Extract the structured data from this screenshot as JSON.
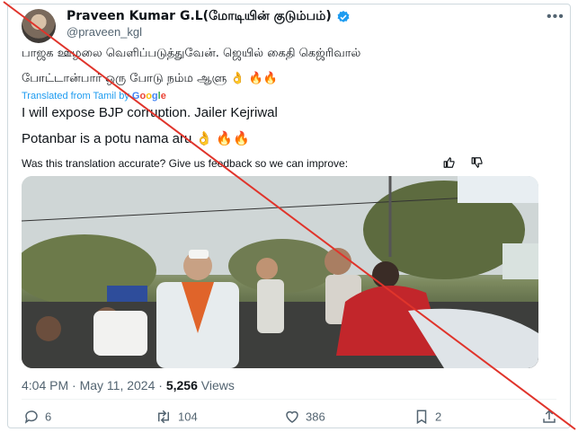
{
  "author": {
    "name": "Praveen Kumar G.L(மோடியின் குடும்பம்)",
    "handle": "@praveen_kgl"
  },
  "tweet": {
    "tamil_line1": "பாஜக ஊழலை வெளிப்படுத்துவேன். ஜெயில் கைதி கெஜ்ரிவால்",
    "tamil_line2": "போட்டான்பார் ஒரு போடு நம்ம ஆளு 👌 🔥🔥",
    "translated_label": "Translated from Tamil by",
    "translated_provider": [
      "G",
      "o",
      "o",
      "g",
      "l",
      "e"
    ],
    "english_line1": "I will expose BJP corruption. Jailer Kejriwal",
    "english_line2": "Potanbar is a potu nama aru 👌 🔥🔥",
    "feedback": "Was this translation accurate? Give us feedback so we can improve:"
  },
  "meta": {
    "timestamp": "4:04 PM · May 11, 2024 · ",
    "views_count": "5,256",
    "views_label": " Views"
  },
  "actions": {
    "replies": "6",
    "reposts": "104",
    "likes": "386",
    "bookmarks": "2"
  },
  "icons": {
    "verified": "verified-badge-icon",
    "more": "more-options-icon",
    "thumbs_up": "thumbs-up-icon",
    "thumbs_down": "thumbs-down-icon",
    "reply": "reply-icon",
    "repost": "repost-icon",
    "like": "heart-icon",
    "bookmark": "bookmark-icon",
    "share": "share-icon"
  },
  "colors": {
    "link_blue": "#1d9bf0",
    "muted": "#536471",
    "fact_check_cross": "#e0342b"
  }
}
